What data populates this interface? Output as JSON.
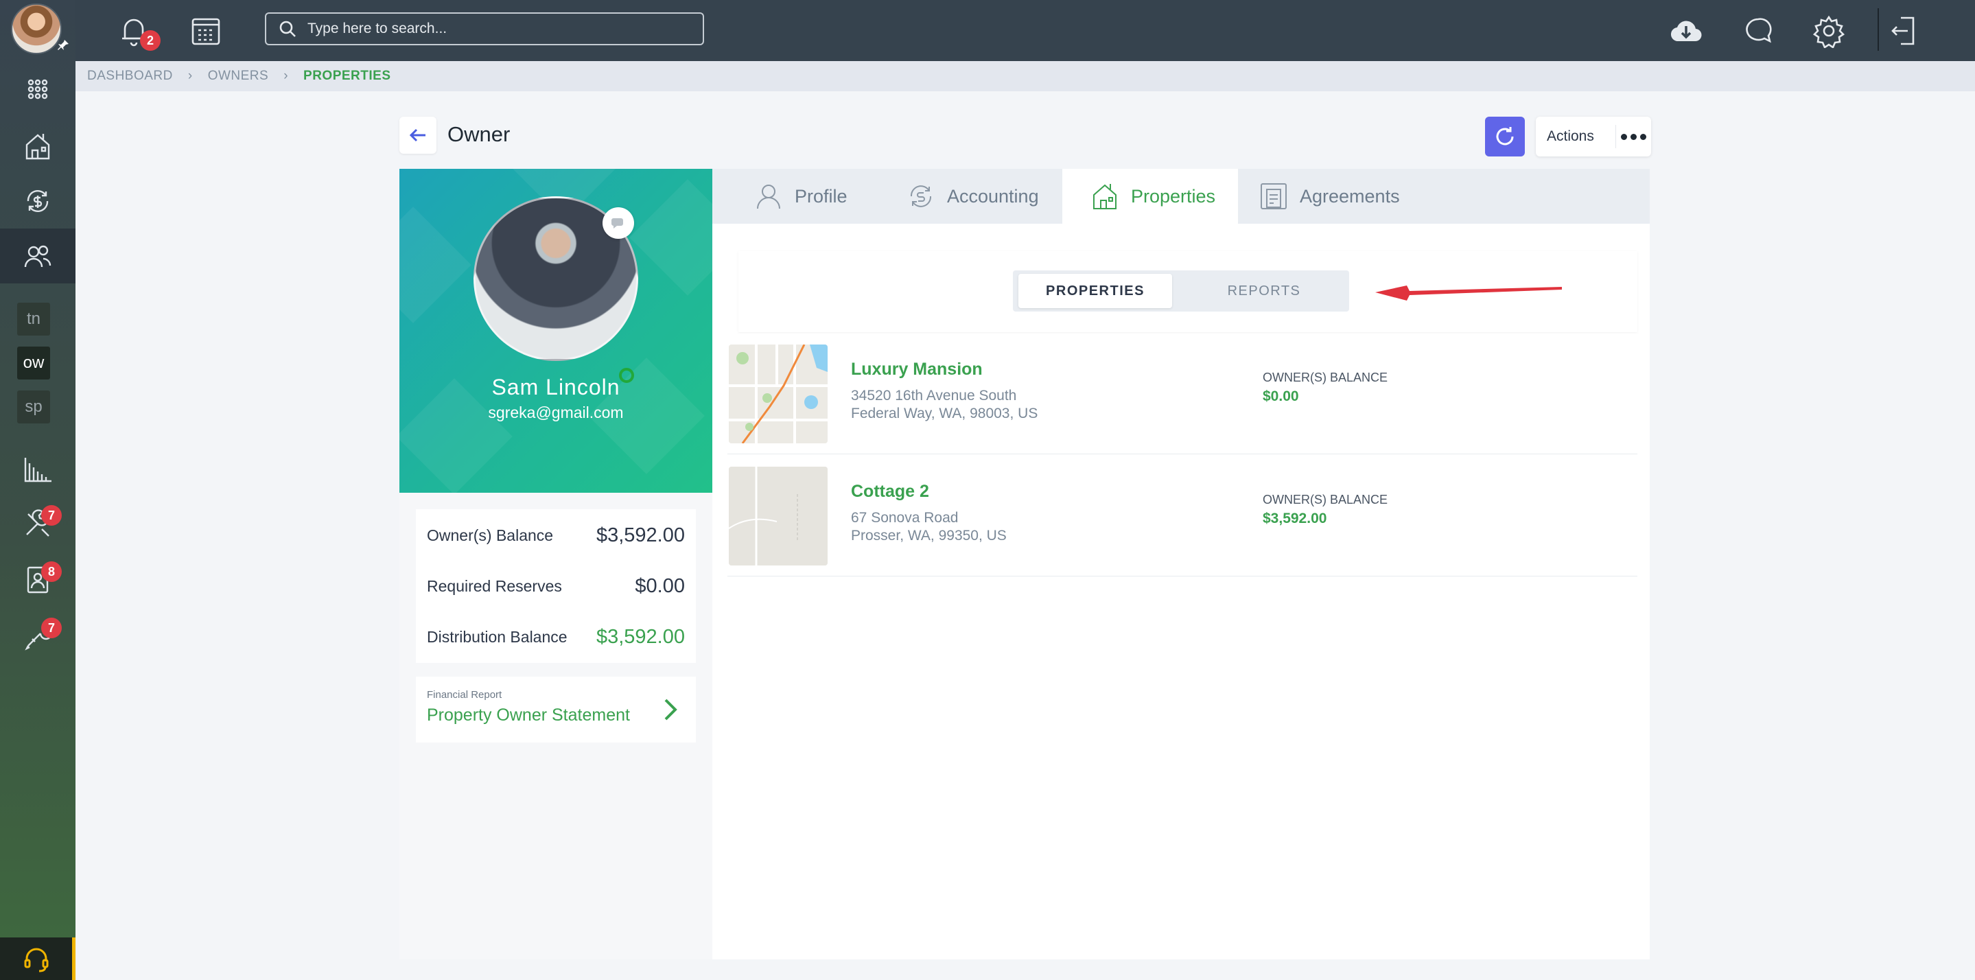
{
  "topbar": {
    "notifications_count": "2",
    "search_placeholder": "Type here to search..."
  },
  "sidebar": {
    "tags": [
      "tn",
      "ow",
      "sp"
    ],
    "badges": {
      "maintenance": "7",
      "applications": "8",
      "services": "7"
    }
  },
  "breadcrumb": [
    "DASHBOARD",
    "OWNERS",
    "PROPERTIES"
  ],
  "page": {
    "title": "Owner",
    "actions_label": "Actions"
  },
  "owner": {
    "name": "Sam Lincoln",
    "email": "sgreka@gmail.com",
    "balances": [
      {
        "label": "Owner(s) Balance",
        "value": "$3,592.00"
      },
      {
        "label": "Required Reserves",
        "value": "$0.00"
      },
      {
        "label": "Distribution Balance",
        "value": "$3,592.00"
      }
    ],
    "report": {
      "kicker": "Financial Report",
      "title": "Property Owner Statement"
    }
  },
  "tabs": [
    {
      "label": "Profile",
      "icon": "user-icon"
    },
    {
      "label": "Accounting",
      "icon": "money-cycle-icon"
    },
    {
      "label": "Properties",
      "icon": "house-icon"
    },
    {
      "label": "Agreements",
      "icon": "document-icon"
    }
  ],
  "segmented": {
    "options": [
      "PROPERTIES",
      "REPORTS"
    ],
    "selected": "PROPERTIES"
  },
  "properties": [
    {
      "name": "Luxury Mansion",
      "address1": "34520 16th Avenue South",
      "address2": "Federal Way, WA, 98003, US",
      "balance_label": "OWNER(S) BALANCE",
      "balance": "$0.00"
    },
    {
      "name": "Cottage 2",
      "address1": "67 Sonova Road",
      "address2": "Prosser, WA, 99350, US",
      "balance_label": "OWNER(S) BALANCE",
      "balance": "$3,592.00"
    }
  ],
  "colors": {
    "accent_green": "#3aa14f",
    "primary_blue": "#6065e8",
    "badge_red": "#e03c44",
    "topbar": "#36434e"
  }
}
